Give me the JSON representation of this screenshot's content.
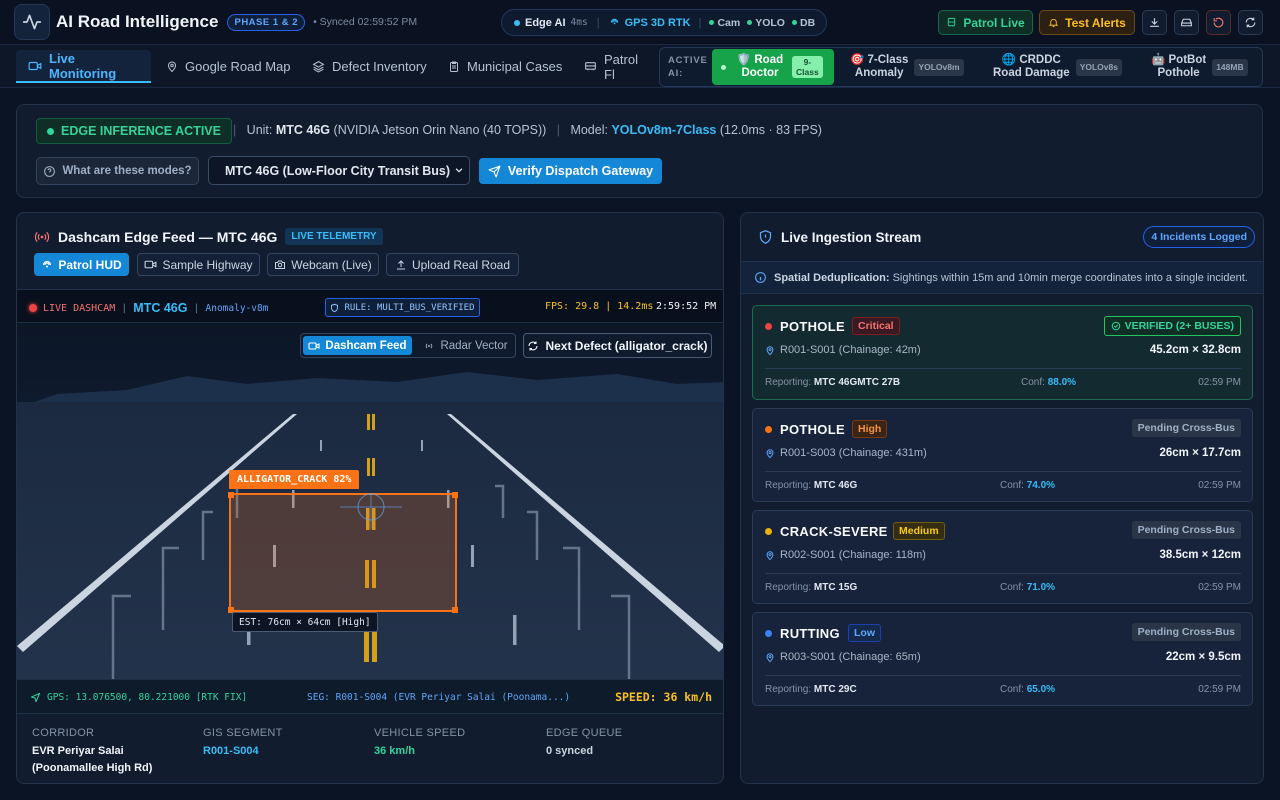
{
  "header": {
    "title": "AI Road Intelligence",
    "phase_badge": "PHASE 1 & 2",
    "synced": "• Synced 02:59:52 PM",
    "status": {
      "edge_label": "Edge AI",
      "edge_latency": "4ms",
      "gps_label": "GPS 3D RTK",
      "cam_label": "Cam",
      "yolo_label": "YOLO",
      "db_label": "DB"
    },
    "patrol_live_label": "Patrol Live",
    "test_alerts_label": "Test Alerts"
  },
  "nav": {
    "tabs": [
      {
        "label": "Live Monitoring",
        "icon": "video-icon"
      },
      {
        "label": "Google Road Map",
        "icon": "map-pin-icon"
      },
      {
        "label": "Defect Inventory",
        "icon": "layers-icon"
      },
      {
        "label": "Municipal Cases",
        "icon": "clipboard-icon"
      },
      {
        "label": "Patrol Fl",
        "icon": "bus-icon"
      }
    ],
    "active_ai": {
      "label_line1": "ACTIVE",
      "label_line2": "AI:",
      "options": [
        {
          "line1": "🛡️ Road",
          "line2": "Doctor",
          "badge_line1": "9-",
          "badge_line2": "Class",
          "selected": true
        },
        {
          "line1": "🎯 7-Class",
          "line2": "Anomaly",
          "badge": "YOLOv8m"
        },
        {
          "line1": "🌐 CRDDC",
          "line2": "Road Damage",
          "badge": "YOLOv8s"
        },
        {
          "line1": "🤖 PotBot",
          "line2": "Pothole",
          "badge": "148MB"
        }
      ]
    }
  },
  "status_card": {
    "edge_badge": "EDGE INFERENCE ACTIVE",
    "unit_label": "Unit:",
    "unit_value": "MTC 46G",
    "unit_hw": "(NVIDIA Jetson Orin Nano (40 TOPS))",
    "model_label": "Model:",
    "model_value": "YOLOv8m-7Class",
    "model_perf": "(12.0ms · 83 FPS)",
    "modes_button": "What are these modes?",
    "unit_select": "MTC 46G (Low-Floor City Transit Bus)",
    "verify_button": "Verify Dispatch Gateway"
  },
  "feed": {
    "title": "Dashcam Edge Feed — MTC 46G",
    "telemetry_badge": "LIVE TELEMETRY",
    "sources": [
      "Patrol HUD",
      "Sample Highway",
      "Webcam (Live)",
      "Upload Real Road"
    ],
    "hud": {
      "live": "LIVE DASHCAM",
      "unit": "MTC 46G",
      "model": "Anomaly-v8m",
      "rule": "RULE: MULTI_BUS_VERIFIED",
      "fps": "FPS: 29.8 | 14.2ms",
      "time": "2:59:52 PM",
      "view_feed": "Dashcam Feed",
      "view_radar": "Radar Vector",
      "next_defect": "Next Defect (alligator_crack)",
      "detection_label": "ALLIGATOR_CRACK 82%",
      "estimate": "EST: 76cm × 64cm [High]",
      "gps": "GPS: 13.076500, 80.221000 [RTK FIX]",
      "segment": "SEG: R001-S004 (EVR Periyar Salai (Poonama...)",
      "speed": "SPEED: 36 km/h"
    },
    "stats": {
      "corridor_label": "CORRIDOR",
      "corridor_line1": "EVR Periyar Salai",
      "corridor_line2": "(Poonamallee High Rd)",
      "segment_label": "GIS SEGMENT",
      "segment_value": "R001-S004",
      "speed_label": "VEHICLE SPEED",
      "speed_value": "36 km/h",
      "queue_label": "EDGE QUEUE",
      "queue_value": "0 synced"
    }
  },
  "ingestion": {
    "title": "Live Ingestion Stream",
    "count_badge": "4 Incidents Logged",
    "info_bold": "Spatial Deduplication:",
    "info_text": "Sightings within 15m and 10min merge coordinates into a single incident.",
    "reporting_label": "Reporting:",
    "conf_label": "Conf:",
    "incidents": [
      {
        "type": "POTHOLE",
        "severity": "Critical",
        "status": "VERIFIED (2+ BUSES)",
        "location": "R001-S001 (Chainage: 42m)",
        "size": "45.2cm × 32.8cm",
        "reporting": "MTC 46GMTC 27B",
        "conf": "88.0%",
        "time": "02:59 PM"
      },
      {
        "type": "POTHOLE",
        "severity": "High",
        "status": "Pending Cross-Bus",
        "location": "R001-S003 (Chainage: 431m)",
        "size": "26cm × 17.7cm",
        "reporting": "MTC 46G",
        "conf": "74.0%",
        "time": "02:59 PM"
      },
      {
        "type": "CRACK-SEVERE",
        "severity": "Medium",
        "status": "Pending Cross-Bus",
        "location": "R002-S001 (Chainage: 118m)",
        "size": "38.5cm × 12cm",
        "reporting": "MTC 15G",
        "conf": "71.0%",
        "time": "02:59 PM"
      },
      {
        "type": "RUTTING",
        "severity": "Low",
        "status": "Pending Cross-Bus",
        "location": "R003-S001 (Chainage: 65m)",
        "size": "22cm × 9.5cm",
        "reporting": "MTC 29C",
        "conf": "65.0%",
        "time": "02:59 PM"
      }
    ]
  },
  "colors": {
    "accent": "#38bdf8",
    "critical": "#ef4444",
    "high": "#f97316",
    "medium": "#eab308",
    "low": "#3b82f6",
    "success": "#34d399",
    "detection": "#f97316"
  }
}
